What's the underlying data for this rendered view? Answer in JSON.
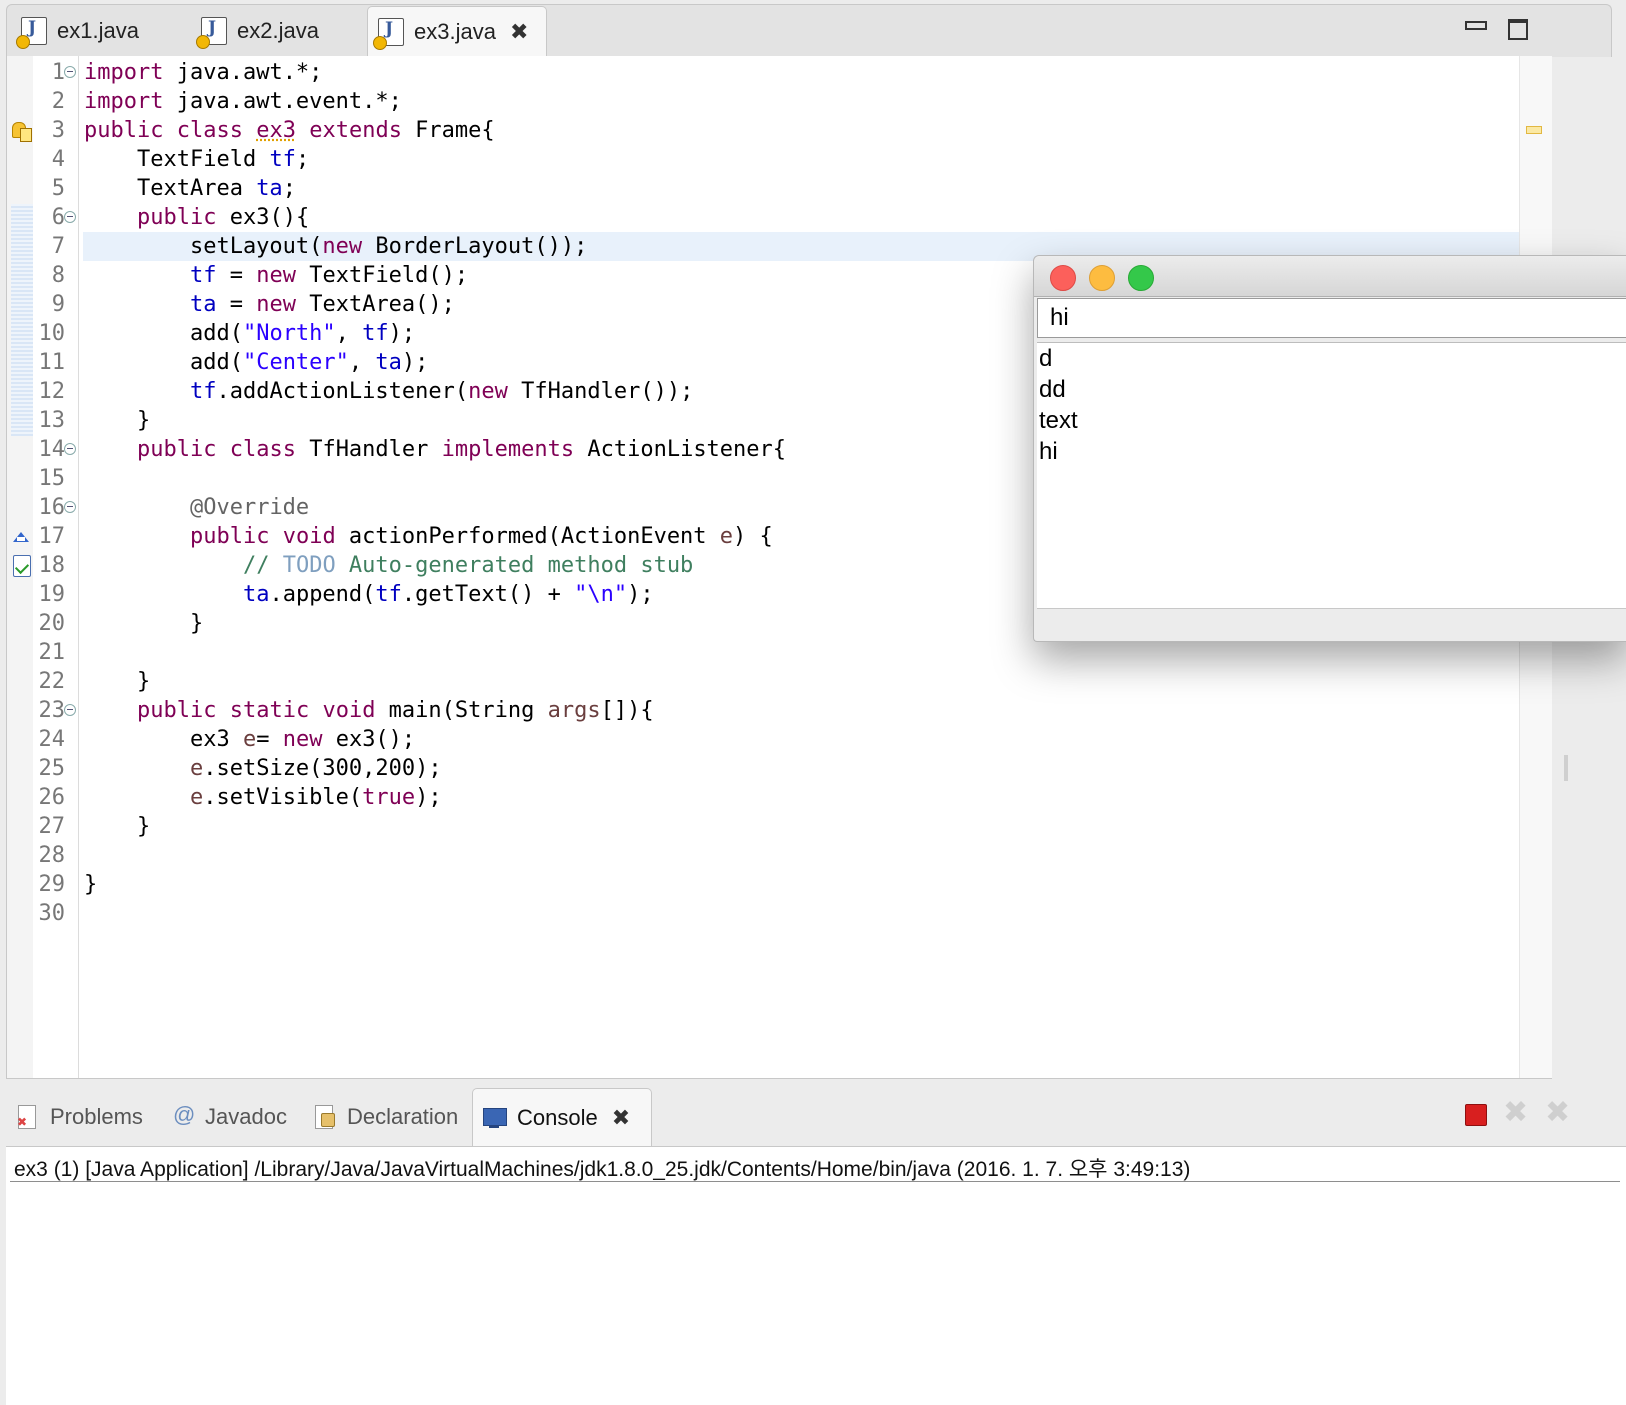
{
  "editor_tabs": [
    {
      "label": "ex1.java"
    },
    {
      "label": "ex2.java"
    },
    {
      "label": "ex3.java",
      "close_icon": "close-x-icon"
    }
  ],
  "code_lines": [
    {
      "num": "1",
      "tokens": [
        [
          "k",
          "import"
        ],
        [
          "p",
          " java.awt.*;"
        ]
      ]
    },
    {
      "num": "2",
      "tokens": [
        [
          "k",
          "import"
        ],
        [
          "p",
          " java.awt.event.*;"
        ]
      ]
    },
    {
      "num": "3",
      "tokens": [
        [
          "k",
          "public"
        ],
        [
          "p",
          " "
        ],
        [
          "k",
          "class"
        ],
        [
          "p",
          " "
        ],
        [
          "w",
          "ex3"
        ],
        [
          "p",
          " "
        ],
        [
          "k",
          "extends"
        ],
        [
          "p",
          " Frame{"
        ]
      ]
    },
    {
      "num": "4",
      "tokens": [
        [
          "p",
          "    TextField "
        ],
        [
          "f",
          "tf"
        ],
        [
          "p",
          ";"
        ]
      ]
    },
    {
      "num": "5",
      "tokens": [
        [
          "p",
          "    TextArea "
        ],
        [
          "f",
          "ta"
        ],
        [
          "p",
          ";"
        ]
      ]
    },
    {
      "num": "6",
      "tokens": [
        [
          "p",
          "    "
        ],
        [
          "k",
          "public"
        ],
        [
          "p",
          " ex3(){"
        ]
      ]
    },
    {
      "num": "7",
      "tokens": [
        [
          "p",
          "        setLayout("
        ],
        [
          "k",
          "new"
        ],
        [
          "p",
          " BorderLayout());"
        ]
      ]
    },
    {
      "num": "8",
      "tokens": [
        [
          "p",
          "        "
        ],
        [
          "f",
          "tf"
        ],
        [
          "p",
          " = "
        ],
        [
          "k",
          "new"
        ],
        [
          "p",
          " TextField();"
        ]
      ]
    },
    {
      "num": "9",
      "tokens": [
        [
          "p",
          "        "
        ],
        [
          "f",
          "ta"
        ],
        [
          "p",
          " = "
        ],
        [
          "k",
          "new"
        ],
        [
          "p",
          " TextArea();"
        ]
      ]
    },
    {
      "num": "10",
      "tokens": [
        [
          "p",
          "        add("
        ],
        [
          "s",
          "\"North\""
        ],
        [
          "p",
          ", "
        ],
        [
          "f",
          "tf"
        ],
        [
          "p",
          ");"
        ]
      ]
    },
    {
      "num": "11",
      "tokens": [
        [
          "p",
          "        add("
        ],
        [
          "s",
          "\"Center\""
        ],
        [
          "p",
          ", "
        ],
        [
          "f",
          "ta"
        ],
        [
          "p",
          ");"
        ]
      ]
    },
    {
      "num": "12",
      "tokens": [
        [
          "p",
          "        "
        ],
        [
          "f",
          "tf"
        ],
        [
          "p",
          ".addActionListener("
        ],
        [
          "k",
          "new"
        ],
        [
          "p",
          " TfHandler());"
        ]
      ]
    },
    {
      "num": "13",
      "tokens": [
        [
          "p",
          "    }"
        ]
      ]
    },
    {
      "num": "14",
      "tokens": [
        [
          "p",
          "    "
        ],
        [
          "k",
          "public"
        ],
        [
          "p",
          " "
        ],
        [
          "k",
          "class"
        ],
        [
          "p",
          " TfHandler "
        ],
        [
          "k",
          "implements"
        ],
        [
          "p",
          " ActionListener{"
        ]
      ]
    },
    {
      "num": "15",
      "tokens": []
    },
    {
      "num": "16",
      "tokens": [
        [
          "p",
          "        "
        ],
        [
          "a",
          "@Override"
        ]
      ]
    },
    {
      "num": "17",
      "tokens": [
        [
          "p",
          "        "
        ],
        [
          "k",
          "public"
        ],
        [
          "p",
          " "
        ],
        [
          "k",
          "void"
        ],
        [
          "p",
          " actionPerformed(ActionEvent "
        ],
        [
          "l",
          "e"
        ],
        [
          "p",
          ") {"
        ]
      ]
    },
    {
      "num": "18",
      "tokens": [
        [
          "p",
          "            "
        ],
        [
          "c",
          "// "
        ],
        [
          "t",
          "TODO"
        ],
        [
          "c",
          " Auto-generated method stub"
        ]
      ]
    },
    {
      "num": "19",
      "tokens": [
        [
          "p",
          "            "
        ],
        [
          "f",
          "ta"
        ],
        [
          "p",
          ".append("
        ],
        [
          "f",
          "tf"
        ],
        [
          "p",
          ".getText() + "
        ],
        [
          "s",
          "\"\\n\""
        ],
        [
          "p",
          ");"
        ]
      ]
    },
    {
      "num": "20",
      "tokens": [
        [
          "p",
          "        }"
        ]
      ]
    },
    {
      "num": "21",
      "tokens": []
    },
    {
      "num": "22",
      "tokens": [
        [
          "p",
          "    }"
        ]
      ]
    },
    {
      "num": "23",
      "tokens": [
        [
          "p",
          "    "
        ],
        [
          "k",
          "public"
        ],
        [
          "p",
          " "
        ],
        [
          "k",
          "static"
        ],
        [
          "p",
          " "
        ],
        [
          "k",
          "void"
        ],
        [
          "p",
          " main(String "
        ],
        [
          "l",
          "args"
        ],
        [
          "p",
          "[]){"
        ]
      ]
    },
    {
      "num": "24",
      "tokens": [
        [
          "p",
          "        ex3 "
        ],
        [
          "l",
          "e"
        ],
        [
          "p",
          "= "
        ],
        [
          "k",
          "new"
        ],
        [
          "p",
          " ex3();"
        ]
      ]
    },
    {
      "num": "25",
      "tokens": [
        [
          "p",
          "        "
        ],
        [
          "l",
          "e"
        ],
        [
          "p",
          ".setSize(300,200);"
        ]
      ]
    },
    {
      "num": "26",
      "tokens": [
        [
          "p",
          "        "
        ],
        [
          "l",
          "e"
        ],
        [
          "p",
          ".setVisible("
        ],
        [
          "k",
          "true"
        ],
        [
          "p",
          ");"
        ]
      ]
    },
    {
      "num": "27",
      "tokens": [
        [
          "p",
          "    }"
        ]
      ]
    },
    {
      "num": "28",
      "tokens": []
    },
    {
      "num": "29",
      "tokens": [
        [
          "p",
          "}"
        ]
      ]
    },
    {
      "num": "30",
      "tokens": []
    }
  ],
  "fold_lines": [
    "1",
    "6",
    "14",
    "16",
    "23"
  ],
  "current_line": "7",
  "gutter_markers": [
    {
      "line": "3",
      "icon": "warning-icon"
    },
    {
      "line": "17",
      "icon": "override-icon"
    },
    {
      "line": "18",
      "icon": "task-icon"
    }
  ],
  "awt_window": {
    "textfield_value": "hi",
    "textarea_lines": [
      "d",
      "dd",
      "text",
      "hi"
    ]
  },
  "view_tabs": [
    {
      "label": "Problems",
      "icon": "problems-icon"
    },
    {
      "label": "Javadoc",
      "icon": "javadoc-icon"
    },
    {
      "label": "Declaration",
      "icon": "declaration-icon"
    },
    {
      "label": "Console",
      "icon": "console-icon",
      "active": true
    }
  ],
  "console": {
    "header": "ex3 (1) [Java Application] /Library/Java/JavaVirtualMachines/jdk1.8.0_25.jdk/Contents/Home/bin/java (2016. 1. 7. 오후 3:49:13)"
  },
  "colors": {
    "keyword": "#7f0055",
    "field": "#0000c0",
    "string": "#2a00ff",
    "comment": "#3f7f5f",
    "current_line": "#e8f1fb"
  }
}
